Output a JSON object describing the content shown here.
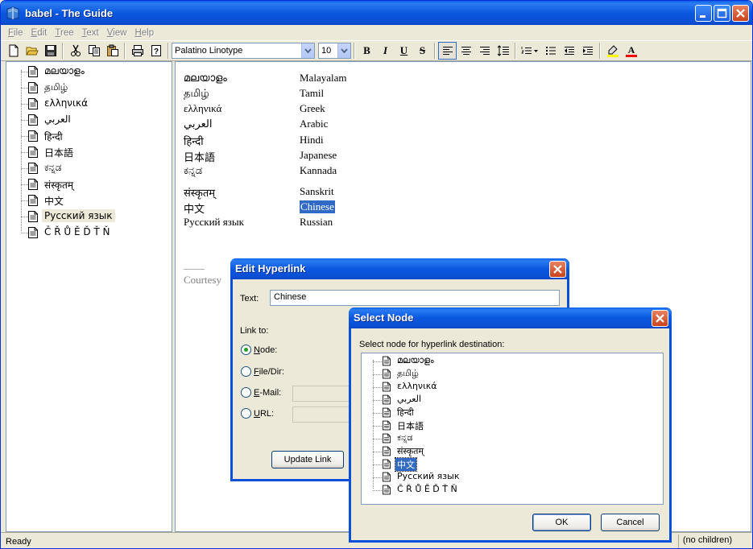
{
  "window": {
    "title": "babel - The Guide"
  },
  "menu": [
    "File",
    "Edit",
    "Tree",
    "Text",
    "View",
    "Help"
  ],
  "toolbar": {
    "font_name": "Palatino Linotype",
    "font_size": "10",
    "bold": "B",
    "italic": "I",
    "underline": "U",
    "strike": "S",
    "text_color_letter": "A"
  },
  "tree": {
    "items": [
      "മലയാളം",
      "தமிழ்",
      "ελληνικά",
      "العربي",
      "हिन्दी",
      "日本語",
      "ಕನ್ನಡ",
      "संस्कृतम्",
      "中文",
      "Русский язык",
      "Č Ř Ů Ě Ď Ť Ň"
    ],
    "selected_index": 9
  },
  "content": {
    "rows": [
      {
        "native": "മലയാളം",
        "english": "Malayalam"
      },
      {
        "native": "தமிழ்",
        "english": "Tamil"
      },
      {
        "native": "ελληνικά",
        "english": "Greek"
      },
      {
        "native": "العربي",
        "english": "Arabic"
      },
      {
        "native": "हिन्दी",
        "english": "Hindi"
      },
      {
        "native": "日本語",
        "english": "Japanese"
      },
      {
        "native": "ಕನ್ನಡ",
        "english": "Kannada"
      },
      {
        "native": "संस्कृतम्",
        "english": "Sanskrit"
      },
      {
        "native": "中文",
        "english": "Chinese"
      },
      {
        "native": "Русский язык",
        "english": "Russian"
      }
    ],
    "selected_english": "Chinese",
    "rule": "____",
    "courtesy": "Courtesy"
  },
  "status": {
    "left": "Ready",
    "right": "(no children)"
  },
  "edit_hyperlink": {
    "title": "Edit Hyperlink",
    "text_label": "Text:",
    "text_value": "Chinese",
    "link_to_label": "Link to:",
    "options": [
      "Node:",
      "File/Dir:",
      "E-Mail:",
      "URL:"
    ],
    "selected_option": "Node:",
    "update_button": "Update Link"
  },
  "select_node": {
    "title": "Select Node",
    "prompt": "Select node for hyperlink destination:",
    "items": [
      "മലയാളം",
      "தமிழ்",
      "ελληνικά",
      "العربي",
      "हिन्दी",
      "日本語",
      "ಕನ್ನಡ",
      "संस्कृतम्",
      "中文",
      "Русский язык",
      "Č Ř Ů Ě Ď Ť Ň"
    ],
    "selected": "中文",
    "ok_button": "OK",
    "cancel_button": "Cancel"
  },
  "colors": {
    "titlebar": "#0a58e0",
    "selection": "#316ac5",
    "highlighter": "#ffff00",
    "font_color": "#ff0000"
  }
}
